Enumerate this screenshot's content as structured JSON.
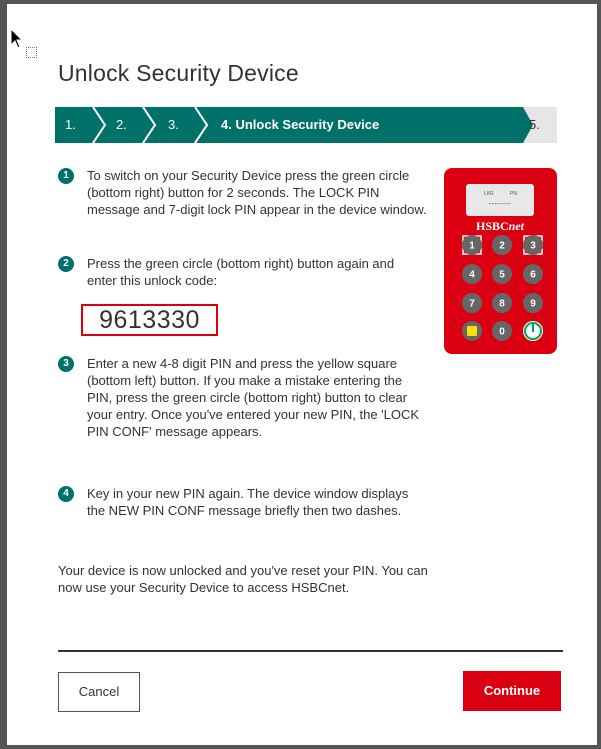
{
  "dialog": {
    "title": "Unlock Security Device"
  },
  "wizard": {
    "steps": [
      {
        "label": "1.",
        "state": "done"
      },
      {
        "label": "2.",
        "state": "done"
      },
      {
        "label": "3.",
        "state": "done"
      },
      {
        "label": "4. Unlock Security Device",
        "state": "active"
      },
      {
        "label": "5.",
        "state": "future"
      }
    ],
    "colors": {
      "done": "#007168",
      "active": "#007168",
      "future": "#e6e6e6"
    }
  },
  "instructions": [
    {
      "number": "1",
      "text": "To switch on your Security Device press the green circle (bottom right) button for 2 seconds. The LOCK PIN message and 7-digit lock PIN appear in the device window."
    },
    {
      "number": "2",
      "text": "Press the green circle (bottom right) button again and enter this unlock code:"
    },
    {
      "number": "3",
      "text": "Enter a new 4-8 digit PIN and press the yellow square (bottom left) button. If you make a mistake entering the PIN, press the green circle (bottom right) button to clear your entry. Once you've entered your new PIN, the 'LOCK PIN CONF' message appears."
    },
    {
      "number": "4",
      "text": "Key in your new PIN again. The device window displays the NEW PIN CONF message briefly then two dashes."
    }
  ],
  "unlock_code": "9613330",
  "final_text": "Your device is now unlocked and you've reset your PIN. You can now use your Security Device to access HSBCnet.",
  "device": {
    "screen_left": "LKR",
    "screen_right": "PN",
    "screen_value": "--------",
    "brand_prefix": "HSBC",
    "brand_suffix": "net",
    "keys": [
      "1",
      "2",
      "3",
      "4",
      "5",
      "6",
      "7",
      "8",
      "9",
      "",
      "0",
      ""
    ],
    "body_color": "#db0011",
    "confirm_key_color": "#00a651",
    "clear_key_color": "#ffe000"
  },
  "buttons": {
    "cancel_label": "Cancel",
    "continue_label": "Continue"
  }
}
